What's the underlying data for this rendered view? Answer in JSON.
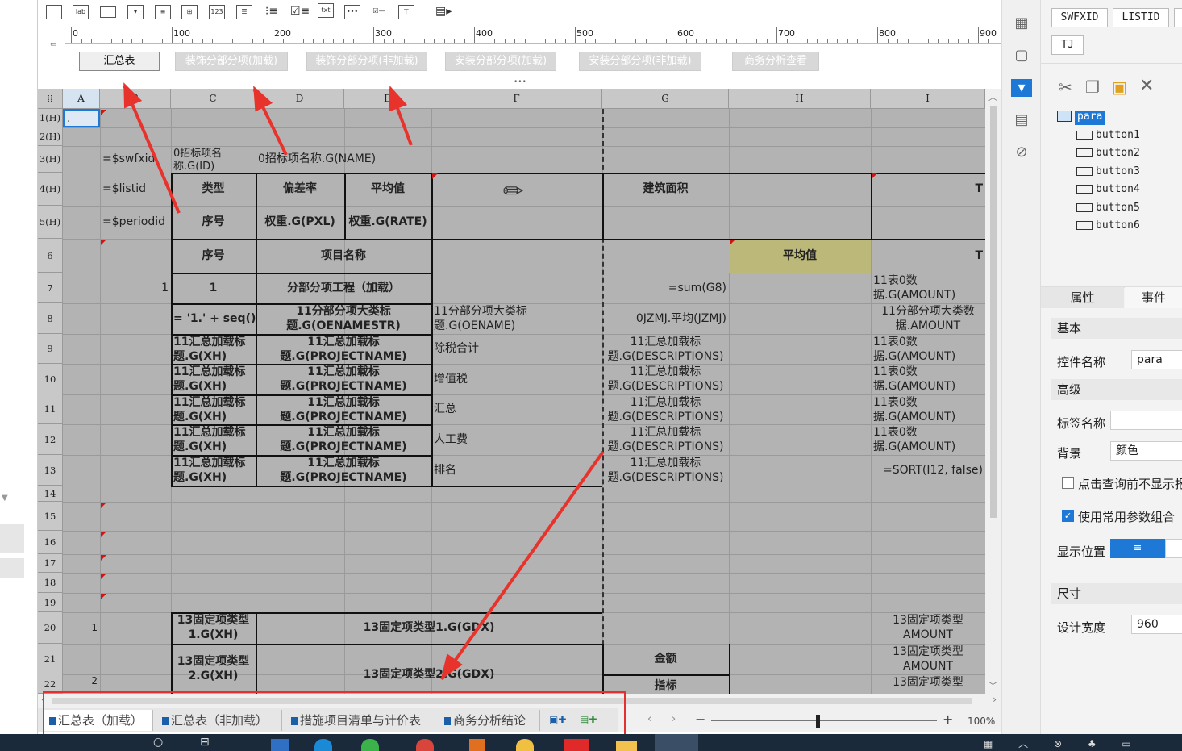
{
  "toolbar": {
    "icons": [
      "textbox-icon",
      "label-icon",
      "button-icon",
      "dropdown-icon",
      "combo-icon",
      "table-icon",
      "number-icon",
      "textarea-icon",
      "radio-icon",
      "checkbox-icon",
      "text-icon",
      "password-icon",
      "toggle-icon",
      "tree-icon",
      "export-icon"
    ],
    "label_lab": "lab",
    "label_123": "123",
    "label_txt": "txt"
  },
  "ruler": {
    "marks": [
      "0",
      "100",
      "200",
      "300",
      "400",
      "500",
      "600",
      "700",
      "800",
      "900"
    ]
  },
  "param_buttons": [
    {
      "label": "汇总表",
      "active": true
    },
    {
      "label": "装饰分部分项(加载)",
      "active": false
    },
    {
      "label": "装饰分部分项(非加载)",
      "active": false
    },
    {
      "label": "安装分部分项(加载)",
      "active": false
    },
    {
      "label": "安装分部分项(非加载)",
      "active": false
    },
    {
      "label": "商务分析查看",
      "active": false
    }
  ],
  "grid": {
    "columns": [
      "A",
      "B",
      "C",
      "D",
      "E",
      "F",
      "G",
      "H",
      "I"
    ],
    "rows": [
      "1(H)",
      "2(H)",
      "3(H)",
      "4(H)",
      "5(H)",
      "6",
      "7",
      "8",
      "9",
      "10",
      "11",
      "12",
      "13",
      "14",
      "15",
      "16",
      "17",
      "18",
      "19",
      "20",
      "21",
      "22"
    ],
    "cells": {
      "a1": ".",
      "b3": "=$swfxid",
      "b4": "=$listid",
      "b5": "=$periodid",
      "c3": "0招标项名称.G(ID)",
      "d3": "0招标项名称.G(NAME)",
      "c4": "类型",
      "d4": "偏差率",
      "e4": "平均值",
      "g4": "建筑面积",
      "i4": "T",
      "c5": "序号",
      "d5": "权重.G(PXL)",
      "e5": "权重.G(RATE)",
      "c6": "序号",
      "d6": "项目名称",
      "h6": "平均值",
      "i6": "T",
      "b7": "1",
      "c7": "1",
      "d7": "分部分项工程（加载）",
      "g7": "=sum(G8)",
      "i7": "11表0数据.G(AMOUNT)",
      "c8": "= '1.' + seq()",
      "d8": "11分部分项大类标题.G(OENAMESTR)",
      "f8": "11分部分项大类标题.G(OENAME)",
      "g8": "0JZMJ.平均(JZMJ)",
      "i8": "11分部分项大类数据.AMOUNT",
      "c9": "11汇总加载标题.G(XH)",
      "d9": "11汇总加载标题.G(PROJECTNAME)",
      "f9": "除税合计",
      "g9": "11汇总加载标题.G(DESCRIPTIONS)",
      "i9": "11表0数据.G(AMOUNT)",
      "c10": "11汇总加载标题.G(XH)",
      "d10": "11汇总加载标题.G(PROJECTNAME)",
      "f10": "增值税",
      "g10": "11汇总加载标题.G(DESCRIPTIONS)",
      "i10": "11表0数据.G(AMOUNT)",
      "c11": "11汇总加载标题.G(XH)",
      "d11": "11汇总加载标题.G(PROJECTNAME)",
      "f11": "汇总",
      "g11": "11汇总加载标题.G(DESCRIPTIONS)",
      "i11": "11表0数据.G(AMOUNT)",
      "c12": "11汇总加载标题.G(XH)",
      "d12": "11汇总加载标题.G(PROJECTNAME)",
      "f12": "人工费",
      "g12": "11汇总加载标题.G(DESCRIPTIONS)",
      "i12": "11表0数据.G(AMOUNT)",
      "c13": "11汇总加载标题.G(XH)",
      "d13": "11汇总加载标题.G(PROJECTNAME)",
      "f13": "排名",
      "g13": "11汇总加载标题.G(DESCRIPTIONS)",
      "i13": "=SORT(I12, false)",
      "a20": "1",
      "c20": "13固定项类型1.G(XH)",
      "d20": "13固定项类型1.G(GDX)",
      "i20": "13固定项类型 AMOUNT",
      "c21": "13固定项类型2.G(XH)",
      "d21": "13固定项类型2.G(GDX)",
      "g21": "金额",
      "i21": "13固定项类型 AMOUNT",
      "a22": "2",
      "g22": "指标",
      "i22": "13固定项类型"
    }
  },
  "sheet_tabs": [
    "汇总表（加载）",
    "汇总表（非加载）",
    "措施项目清单与计价表",
    "商务分析结论"
  ],
  "zoom": {
    "value": "100%",
    "minus": "−",
    "plus": "+"
  },
  "right_panel": {
    "param_tags": [
      "SWFXID",
      "LISTID",
      "TJ"
    ],
    "tree_root": "para",
    "tree_children": [
      "button1",
      "button2",
      "button3",
      "button4",
      "button5",
      "button6"
    ],
    "tab_props": "属性",
    "tab_events": "事件",
    "section_basic": "基本",
    "control_name_label": "控件名称",
    "control_name_value": "para",
    "section_advanced": "高级",
    "label_name_label": "标签名称",
    "label_name_value": "",
    "background_label": "背景",
    "background_value": "颜色",
    "hide_before_query_label": "点击查询前不显示报",
    "hide_before_query_checked": false,
    "use_common_params_label": "使用常用参数组合",
    "use_common_params_checked": true,
    "display_pos_label": "显示位置",
    "section_size": "尺寸",
    "design_width_label": "设计宽度",
    "design_width_value": "960"
  },
  "colors": {
    "accent": "#1e78d6",
    "annotation": "#e8332d",
    "grid_bg": "#b3b3b3",
    "highlight_cell": "#bcb87a"
  }
}
